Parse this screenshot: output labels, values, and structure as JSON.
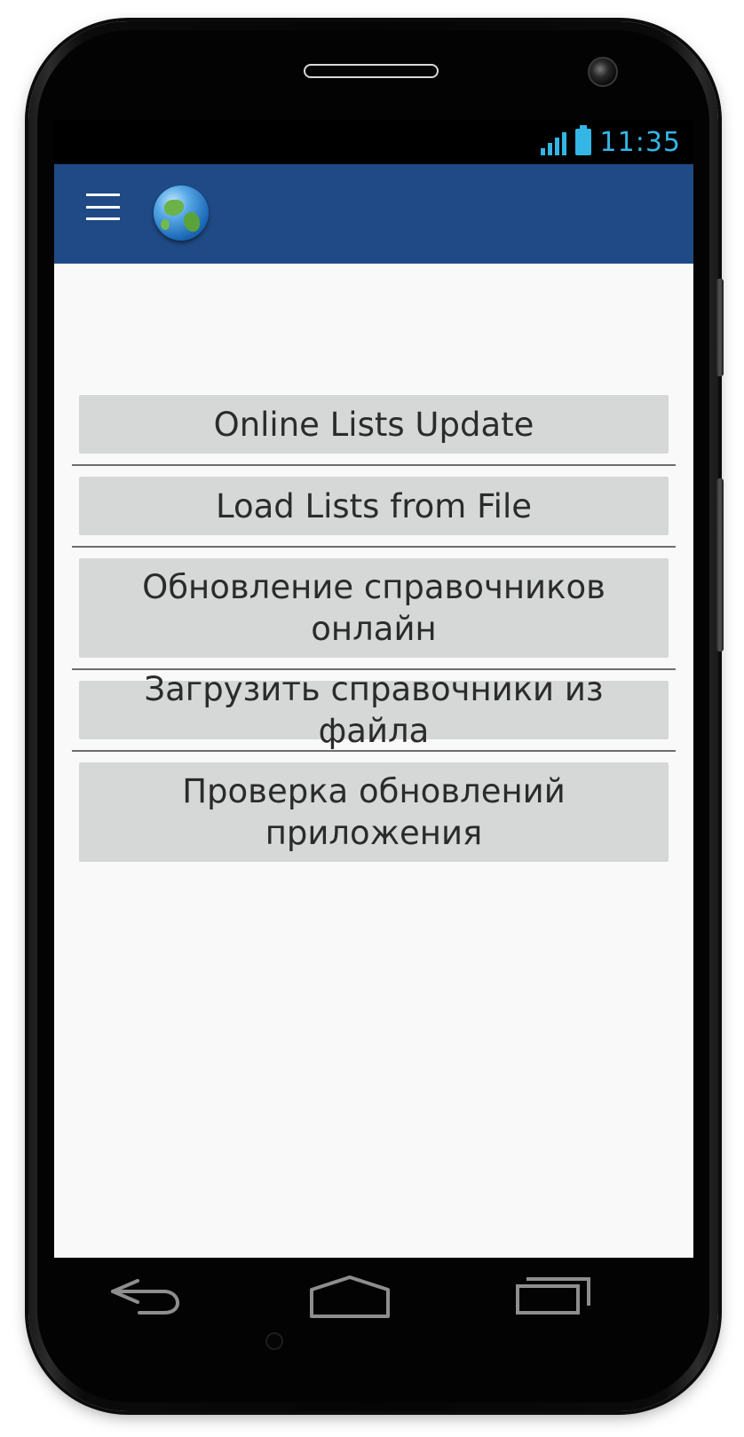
{
  "status_bar": {
    "time": "11:35",
    "icons": [
      "signal-icon",
      "battery-icon"
    ],
    "accent_color": "#33b5e5"
  },
  "app_bar": {
    "background_color": "#1f4a85",
    "icons": [
      "menu-icon",
      "globe-icon"
    ]
  },
  "menu": {
    "items": [
      {
        "label": "Online Lists Update"
      },
      {
        "label": "Load Lists from File"
      },
      {
        "label": "Обновление справочников\nонлайн"
      },
      {
        "label": "Загрузить справочники из файла"
      },
      {
        "label": "Проверка обновлений\nприложения"
      }
    ]
  },
  "nav_bar": {
    "icons": [
      "back-icon",
      "home-icon",
      "recent-apps-icon"
    ]
  }
}
